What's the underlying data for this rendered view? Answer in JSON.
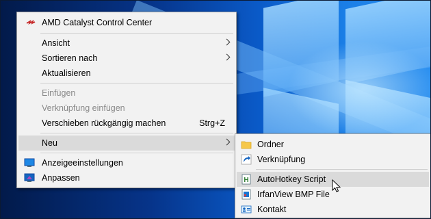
{
  "main_menu": {
    "header_item": {
      "label": "AMD Catalyst Control Center",
      "icon": "amd-catalyst-icon"
    },
    "items": [
      {
        "label": "Ansicht",
        "submenu": true
      },
      {
        "label": "Sortieren nach",
        "submenu": true
      },
      {
        "label": "Aktualisieren"
      },
      {
        "label": "Einfügen",
        "disabled": true
      },
      {
        "label": "Verknüpfung einfügen",
        "disabled": true
      },
      {
        "label": "Verschieben rückgängig machen",
        "shortcut": "Strg+Z"
      },
      {
        "label": "Neu",
        "submenu": true,
        "highlighted": true
      },
      {
        "label": "Anzeigeeinstellungen",
        "icon": "display-settings-icon"
      },
      {
        "label": "Anpassen",
        "icon": "personalize-icon"
      }
    ]
  },
  "submenu_neu": {
    "items": [
      {
        "label": "Ordner",
        "icon": "folder-icon"
      },
      {
        "label": "Verknüpfung",
        "icon": "shortcut-icon"
      },
      {
        "label": "AutoHotkey Script",
        "icon": "autohotkey-script-icon",
        "highlighted": true
      },
      {
        "label": "IrfanView BMP File",
        "icon": "irfanview-bmp-icon"
      },
      {
        "label": "Kontakt",
        "icon": "contact-icon"
      }
    ]
  },
  "colors": {
    "menu_background": "#f2f2f2",
    "highlight": "#dadada",
    "disabled_text": "#8a8a8a"
  }
}
